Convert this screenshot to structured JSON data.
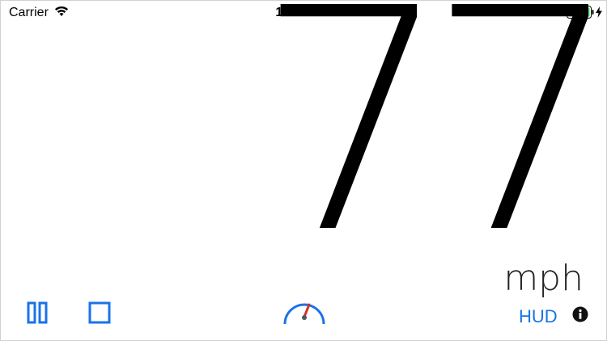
{
  "status_bar": {
    "carrier": "Carrier",
    "time": "10:50 PM",
    "battery_color": "#4cd964"
  },
  "speedometer": {
    "speed": "77",
    "unit": "mph"
  },
  "controls": {
    "hud_label": "HUD",
    "accent_color": "#1a73e8",
    "needle_color": "#d0312d",
    "icons": [
      "pause-icon",
      "stop-icon",
      "speedometer-icon",
      "info-icon"
    ]
  }
}
